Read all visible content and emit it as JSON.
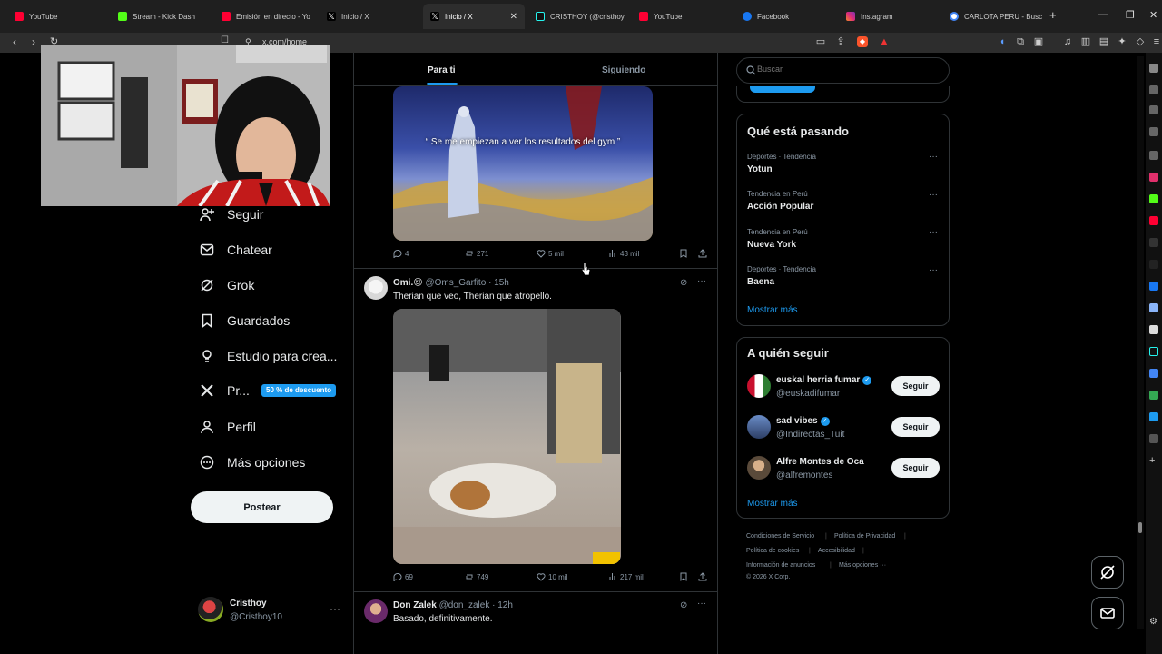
{
  "browser": {
    "tabs": [
      {
        "label": "YouTube",
        "color": "#ff0033"
      },
      {
        "label": "Stream - Kick Dash",
        "color": "#53fc18"
      },
      {
        "label": "Emisión en directo - Yo",
        "color": "#ff0033"
      },
      {
        "label": "Inicio / X",
        "color": "#ffffff"
      },
      {
        "label": "Inicio / X",
        "color": "#ffffff",
        "active": true
      },
      {
        "label": "CRISTHOY (@cristhoy",
        "color": "#25f4ee"
      },
      {
        "label": "YouTube",
        "color": "#ff0033"
      },
      {
        "label": "Facebook",
        "color": "#1877f2"
      },
      {
        "label": "Instagram",
        "color": "#e1306c"
      },
      {
        "label": "CARLOTA PERU - Busc",
        "color": "#4285f4"
      }
    ],
    "new_tab": "+",
    "url": "x.com/home"
  },
  "left_nav": {
    "items": [
      {
        "icon": "follow-icon",
        "label": "Seguir"
      },
      {
        "icon": "chat-icon",
        "label": "Chatear"
      },
      {
        "icon": "grok-icon",
        "label": "Grok"
      },
      {
        "icon": "bookmark-icon",
        "label": "Guardados"
      },
      {
        "icon": "lightbulb-icon",
        "label": "Estudio para crea..."
      },
      {
        "icon": "x-logo-icon",
        "label": "Pr..."
      },
      {
        "icon": "person-icon",
        "label": "Perfil"
      },
      {
        "icon": "more-circle-icon",
        "label": "Más opciones"
      }
    ],
    "premium_badge": "50 % de descuento",
    "post_button": "Postear",
    "profile": {
      "name": "Cristhoy",
      "handle": "@Cristhoy10",
      "more": "···"
    }
  },
  "feed": {
    "tabs": [
      "Para ti",
      "Siguiendo"
    ],
    "active_tab": 0,
    "first_post": {
      "image_caption": "“ Se me empiezan a ver los resultados del gym ”",
      "replies": "4",
      "reposts": "271",
      "likes": "5 mil",
      "views": "43 mil"
    },
    "second_post": {
      "name": "Omi.😌",
      "handle": "@Oms_Garfito",
      "time": "· 15h",
      "text": "Therian que veo, Therian que atropello.",
      "replies": "69",
      "reposts": "749",
      "likes": "10 mil",
      "views": "217 mil"
    },
    "third_post": {
      "name": "Don Zalek",
      "handle": "@don_zalek",
      "time": "· 12h",
      "text": "Basado, definitivamente."
    }
  },
  "sidebar": {
    "search_placeholder": "Buscar",
    "trending": {
      "title": "Qué está pasando",
      "items": [
        {
          "meta": "Deportes · Tendencia",
          "name": "Yotun"
        },
        {
          "meta": "Tendencia en Perú",
          "name": "Acción Popular"
        },
        {
          "meta": "Tendencia en Perú",
          "name": "Nueva York"
        },
        {
          "meta": "Deportes · Tendencia",
          "name": "Baena"
        }
      ],
      "show_more": "Mostrar más"
    },
    "who_to_follow": {
      "title": "A quién seguir",
      "items": [
        {
          "name": "euskal herria fumar",
          "handle": "@euskadifumar",
          "verified": true,
          "button": "Seguir"
        },
        {
          "name": "sad vibes",
          "handle": "@Indirectas_Tuit",
          "verified": true,
          "button": "Seguir"
        },
        {
          "name": "Alfre Montes de Oca",
          "handle": "@alfremontes",
          "verified": false,
          "button": "Seguir"
        }
      ],
      "show_more": "Mostrar más"
    },
    "footer": {
      "links": [
        "Condiciones de Servicio",
        "Política de Privacidad",
        "Política de cookies",
        "Accesibilidad",
        "Información de anuncios",
        "Más opciones ···"
      ],
      "copyright": "© 2026 X Corp."
    }
  },
  "colors": {
    "accent": "#1d9bf0",
    "background": "#000000",
    "border": "#2f3336",
    "muted": "#8b98a5"
  }
}
